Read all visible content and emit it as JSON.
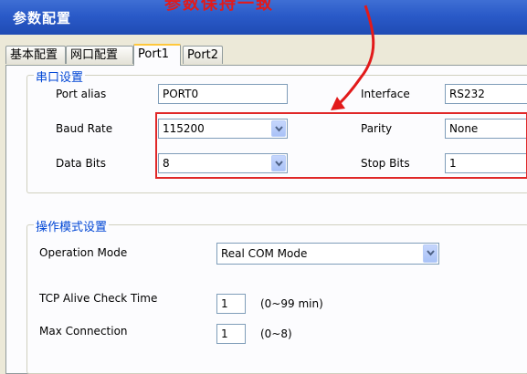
{
  "window": {
    "title": "参数配置",
    "annotation": "参数保持一致"
  },
  "tabs": [
    {
      "label": "基本配置"
    },
    {
      "label": "网口配置"
    },
    {
      "label": "Port1"
    },
    {
      "label": "Port2"
    }
  ],
  "serial_group": {
    "title": "串口设置",
    "port_alias_label": "Port alias",
    "port_alias_value": "PORT0",
    "interface_label": "Interface",
    "interface_value": "RS232",
    "baud_rate_label": "Baud Rate",
    "baud_rate_value": "115200",
    "parity_label": "Parity",
    "parity_value": "None",
    "data_bits_label": "Data Bits",
    "data_bits_value": "8",
    "stop_bits_label": "Stop Bits",
    "stop_bits_value": "1"
  },
  "operation_group": {
    "title": "操作模式设置",
    "operation_mode_label": "Operation Mode",
    "operation_mode_value": "Real COM Mode",
    "tcp_alive_label": "TCP Alive Check Time",
    "tcp_alive_value": "1",
    "tcp_alive_hint": "(0~99 min)",
    "max_connection_label": "Max Connection",
    "max_connection_value": "1",
    "max_connection_hint": "(0~8)"
  },
  "colors": {
    "annotation": "#e21a1a",
    "titlebar": "#2a5ac8",
    "group_title": "#0046d5"
  },
  "icons": {
    "dropdown": "chevron-down-icon",
    "annotation_arrow": "arrow-icon"
  }
}
